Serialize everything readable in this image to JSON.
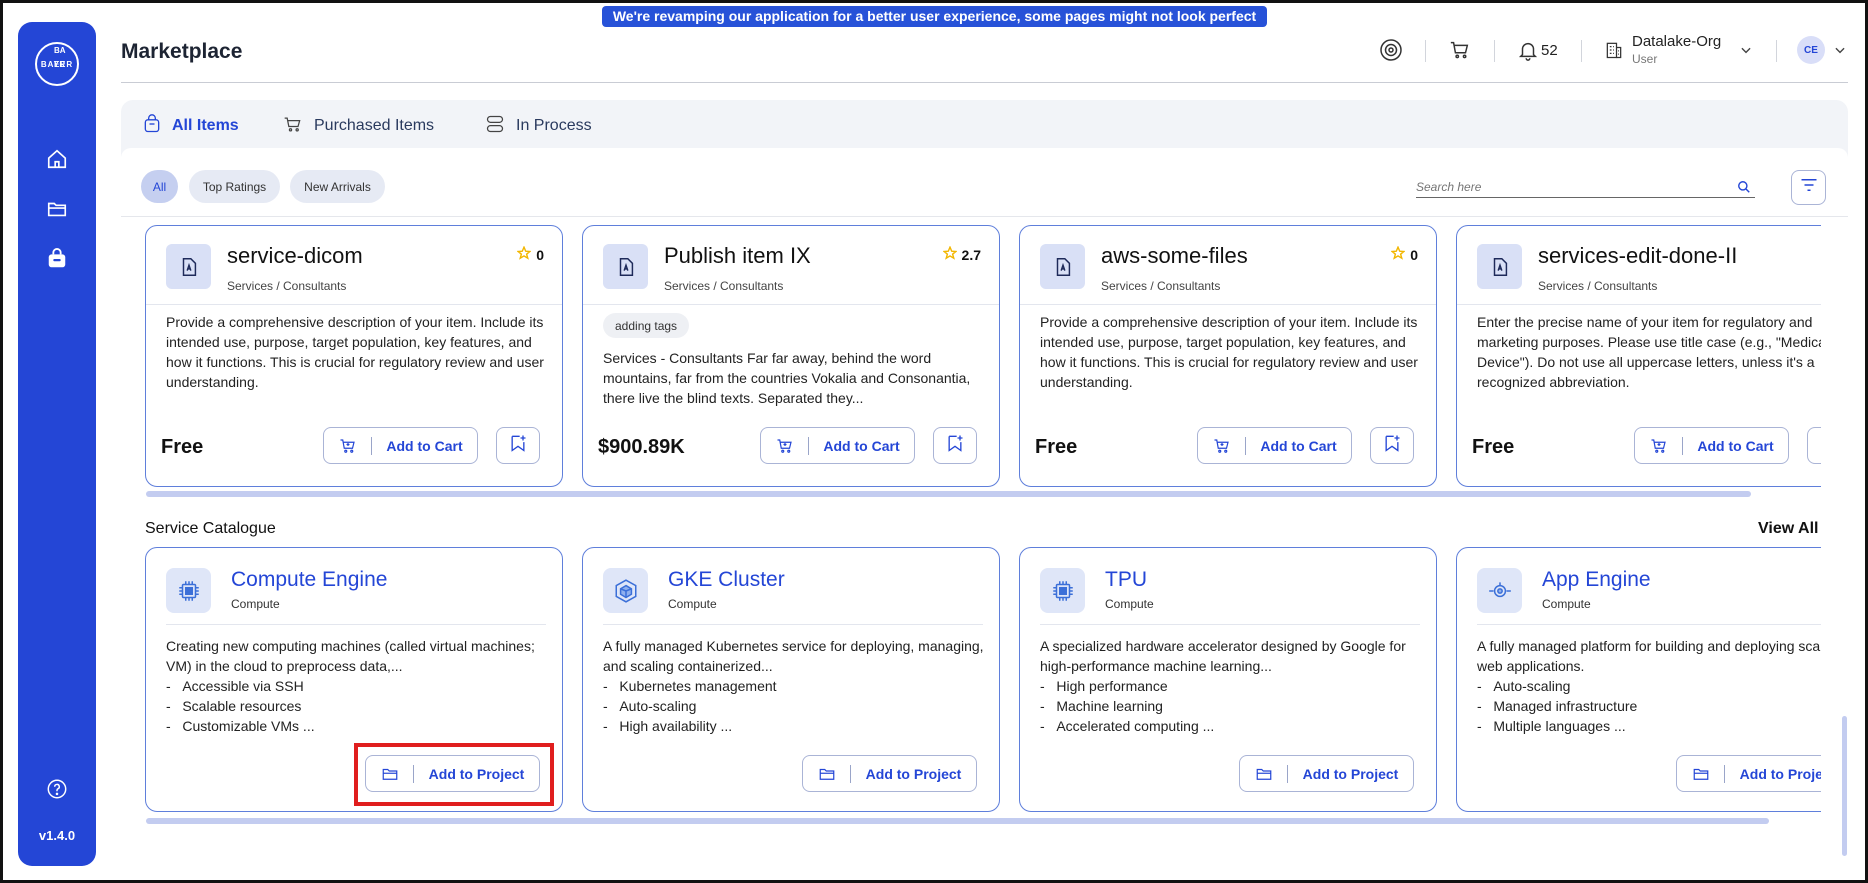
{
  "banner": "We're revamping our application for a better user experience, some pages might not look perfect yet!",
  "sidebar": {
    "logo_h": "BAYER",
    "logo_v": [
      "B",
      "A",
      "Y",
      "E",
      "R"
    ],
    "icons": [
      "home-icon",
      "folder-icon",
      "marketplace-bag-icon"
    ],
    "help_icon": "help-circle-icon",
    "version": "v1.4.0"
  },
  "header": {
    "title": "Marketplace",
    "notifications": "52",
    "org": "Datalake-Org",
    "role": "User",
    "avatar": "CE"
  },
  "tabs": [
    {
      "label": "All Items",
      "icon": "bag-icon",
      "active": true
    },
    {
      "label": "Purchased Items",
      "icon": "cart-icon",
      "active": false
    },
    {
      "label": "In Process",
      "icon": "stack-icon",
      "active": false
    }
  ],
  "filters": {
    "chips": [
      "All",
      "Top Ratings",
      "New Arrivals"
    ],
    "active_chip": "All",
    "search_placeholder": "Search here"
  },
  "items": [
    {
      "title": "service-dicom",
      "category": "Services / Consultants",
      "rating": "0",
      "tag": "",
      "description": "Provide a comprehensive description of your item. Include its intended use, purpose, target population, key features, and how it functions. This is crucial for regulatory review and user understanding.",
      "price": "Free",
      "cart_label": "Add to Cart"
    },
    {
      "title": "Publish item IX",
      "category": "Services / Consultants",
      "rating": "2.7",
      "tag": "adding tags",
      "description": "Services - Consultants Far far away, behind the word mountains, far from the countries Vokalia and Consonantia, there live the blind texts. Separated they...",
      "price": "$900.89K",
      "cart_label": "Add to Cart"
    },
    {
      "title": "aws-some-files",
      "category": "Services / Consultants",
      "rating": "0",
      "tag": "",
      "description": "Provide a comprehensive description of your item. Include its intended use, purpose, target population, key features, and how it functions. This is crucial for regulatory review and user understanding.",
      "price": "Free",
      "cart_label": "Add to Cart"
    },
    {
      "title": "services-edit-done-II",
      "category": "Services / Consultants",
      "rating": "",
      "tag": "",
      "description": "Enter the precise name of your item for regulatory and marketing purposes. Please use title case (e.g., \"Medical Device\"). Do not use all uppercase letters, unless it's a recognized abbreviation.",
      "price": "Free",
      "cart_label": "Add to Cart"
    }
  ],
  "catalogue": {
    "title": "Service Catalogue",
    "view_all": "View All",
    "items": [
      {
        "title": "Compute Engine",
        "subtitle": "Compute",
        "icon": "cpu-chip-icon",
        "description": "Creating new computing machines (called virtual machines; VM) in the cloud to preprocess data,...",
        "features": [
          "Accessible via SSH",
          "Scalable resources",
          "Customizable VMs ..."
        ],
        "button": "Add to Project"
      },
      {
        "title": "GKE Cluster",
        "subtitle": "Compute",
        "icon": "kubernetes-cube-icon",
        "description": "A fully managed Kubernetes service for deploying, managing, and scaling containerized...",
        "features": [
          "Kubernetes management",
          "Auto-scaling",
          "High availability ..."
        ],
        "button": "Add to Project"
      },
      {
        "title": "TPU",
        "subtitle": "Compute",
        "icon": "tpu-chip-icon",
        "description": "A specialized hardware accelerator designed by Google for high-performance machine learning...",
        "features": [
          "High performance",
          "Machine learning",
          "Accelerated computing ..."
        ],
        "button": "Add to Project"
      },
      {
        "title": "App Engine",
        "subtitle": "Compute",
        "icon": "app-engine-icon",
        "description": "A fully managed platform for building and deploying scalable web applications.",
        "features": [
          "Auto-scaling",
          "Managed infrastructure",
          "Multiple languages ..."
        ],
        "button": "Add to Project"
      }
    ]
  },
  "colors": {
    "accent": "#2446d6",
    "highlight": "#e01e1e",
    "star": "#f2b600"
  }
}
